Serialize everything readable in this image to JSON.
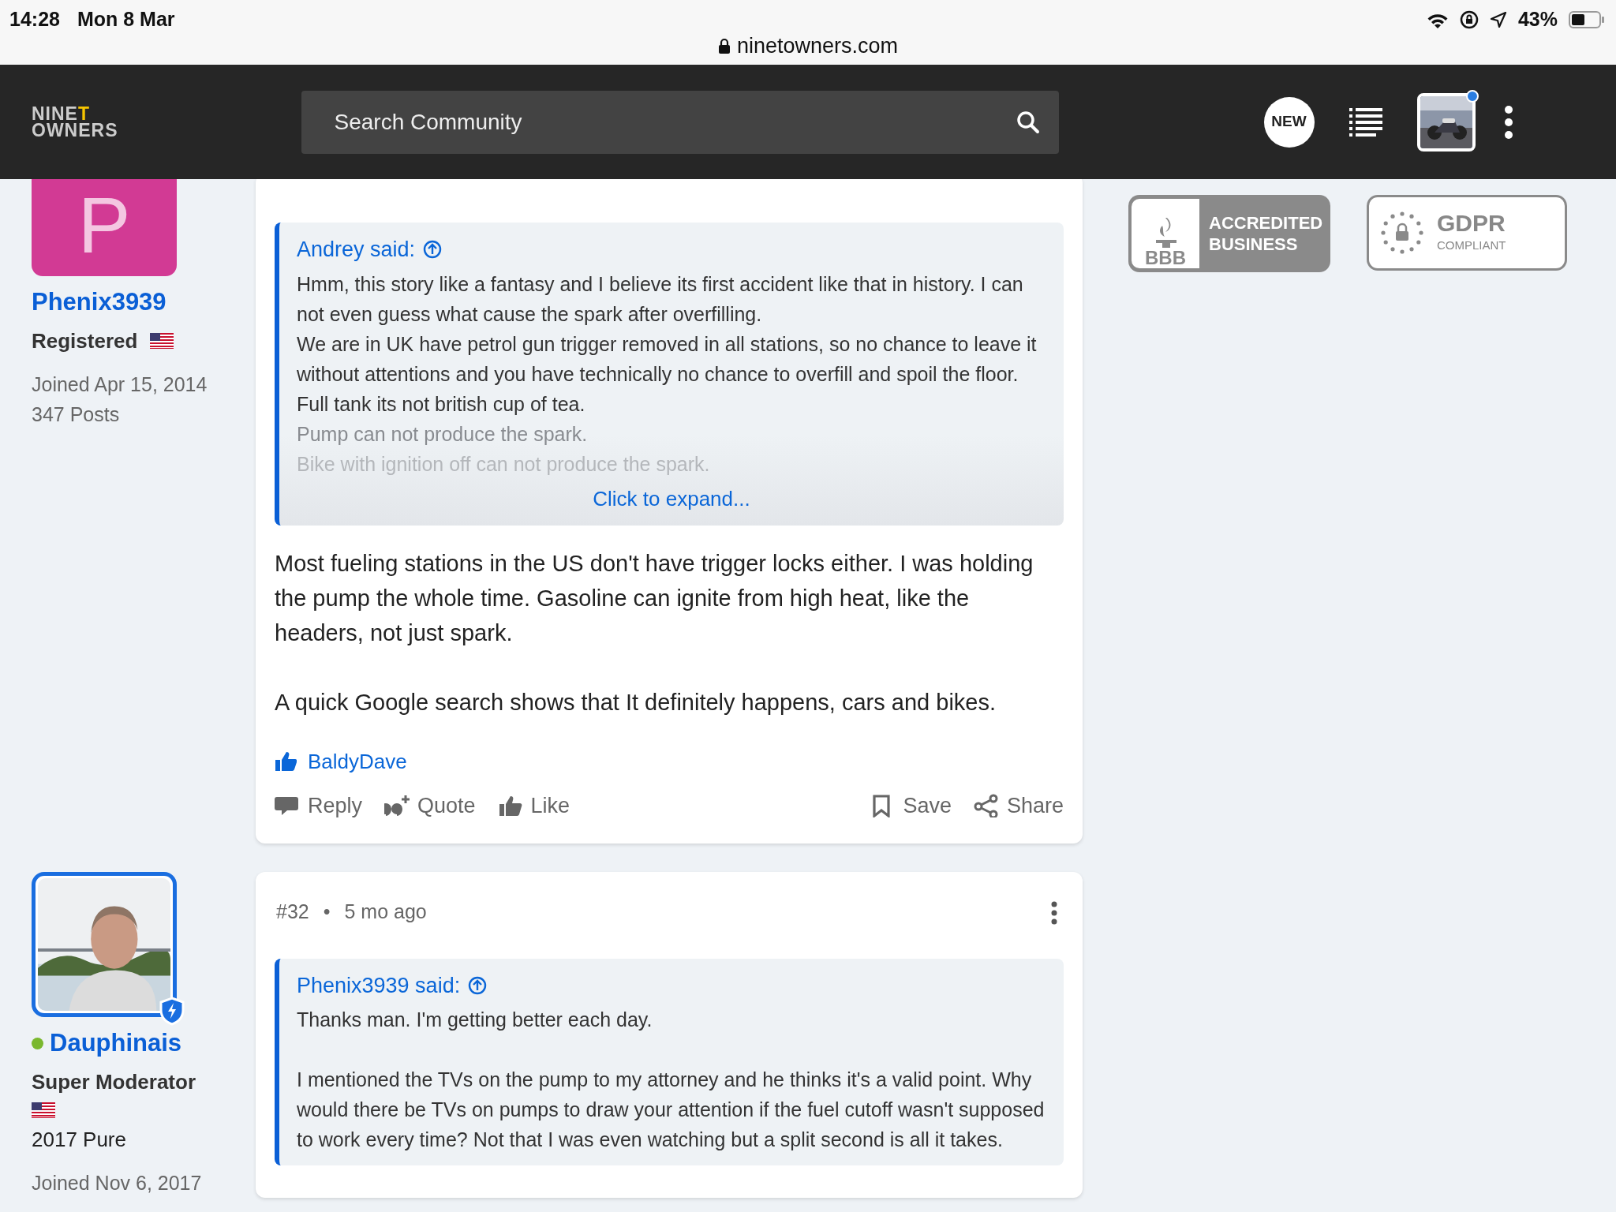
{
  "status_bar": {
    "time": "14:28",
    "date": "Mon 8 Mar",
    "url": "ninetowners.com",
    "battery": "43%"
  },
  "navbar": {
    "logo": {
      "text": "NINE",
      "accent": "T",
      "line2": "OWNERS"
    },
    "search": {
      "placeholder": "Search Community"
    },
    "new_button": "NEW",
    "notification": true
  },
  "posts": [
    {
      "author": {
        "avatar": {
          "kind": "letter",
          "letter": "P"
        },
        "name": "Phenix3939",
        "role": "Registered",
        "flag": true,
        "stats": [
          "Joined Apr 15, 2014",
          "347 Posts"
        ]
      },
      "quote": {
        "author": "Andrey said:",
        "collapsed": true,
        "lines": [
          "Hmm, this story like a fantasy and I believe its first accident like that in history. I can not even guess what cause the spark after overfilling.",
          "We are in UK have petrol gun trigger removed in all stations, so no chance to leave it without attentions and you have technically no chance to overfill and spoil the floor. Full tank its not british cup of tea.",
          "Pump can not produce the spark.",
          "Bike with ignition off can not produce the spark."
        ],
        "expand_label": "Click to expand..."
      },
      "body": [
        "Most fueling stations in the US don't have trigger locks either. I was holding the pump the whole time. Gasoline can ignite from high heat, like the headers, not just spark.",
        "A quick Google search shows that It definitely happens, cars and bikes."
      ],
      "likes": [
        "BaldyDave"
      ],
      "actions": [
        {
          "kind": "reply",
          "label": "Reply"
        },
        {
          "kind": "quote",
          "label": "Quote"
        },
        {
          "kind": "like",
          "label": "Like"
        },
        {
          "kind": "save",
          "label": "Save"
        },
        {
          "kind": "share",
          "label": "Share"
        }
      ]
    },
    {
      "author": {
        "avatar": {
          "kind": "picture"
        },
        "name": "Dauphinais",
        "online": true,
        "moderator": true,
        "role": "Super Moderator",
        "flag": true,
        "details": [
          "2017 Pure"
        ],
        "stats": [
          "Joined Nov 6, 2017"
        ]
      },
      "header": {
        "number": "#32",
        "separator": "•",
        "time": "5 mo ago"
      },
      "quote": {
        "author": "Phenix3939 said:",
        "collapsed": false,
        "paragraphs": [
          "Thanks man. I'm getting better each day.",
          "I mentioned the TVs on the pump to my attorney and he thinks it's a valid point. Why would there be TVs on pumps to draw your attention if the fuel cutoff wasn't supposed to work every time? Not that I was even watching but a split second is all it takes."
        ]
      }
    }
  ],
  "badges": [
    {
      "kind": "bbb",
      "mark": "BBB",
      "line1": "ACCREDITED",
      "line2": "BUSINESS"
    },
    {
      "kind": "gdpr",
      "line1": "GDPR",
      "line2": "COMPLIANT"
    }
  ]
}
